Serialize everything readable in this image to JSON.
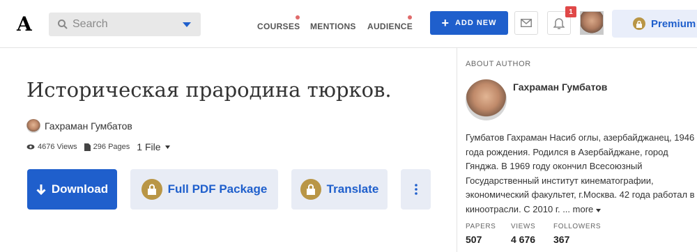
{
  "header": {
    "logo": "A",
    "search_placeholder": "Search",
    "nav": [
      "COURSES",
      "MENTIONS",
      "AUDIENCE"
    ],
    "add_new_label": "ADD NEW",
    "notification_count": "1",
    "premium_label": "Premium"
  },
  "paper": {
    "title": "Историческая прародина тюрков.",
    "author": "Гахраман Гумбатов",
    "views": "4676 Views",
    "pages": "296 Pages",
    "files": "1 File"
  },
  "actions": {
    "download": "Download",
    "full_pdf": "Full PDF Package",
    "translate": "Translate"
  },
  "about_author": {
    "label": "ABOUT AUTHOR",
    "name": "Гахраман Гумбатов",
    "bio": "Гумбатов Гахраман Насиб оглы, азербайджанец, 1946\nгода рождения. Родился в Азербайджане, город\nГянджа. В 1969 году окончил Всесоюзный\nГосударственный институт кинематографии,\nэкономический факультет, г.Москва. 42 года работал в\nкиноотрасли. С 2010 г. ...",
    "more": "more",
    "stats": [
      {
        "label": "PAPERS",
        "value": "507"
      },
      {
        "label": "VIEWS",
        "value": "4 676"
      },
      {
        "label": "FOLLOWERS",
        "value": "367"
      }
    ]
  },
  "colors": {
    "accent": "#1f5fcc",
    "premium_lock": "#b99646",
    "notification": "#e04848"
  }
}
